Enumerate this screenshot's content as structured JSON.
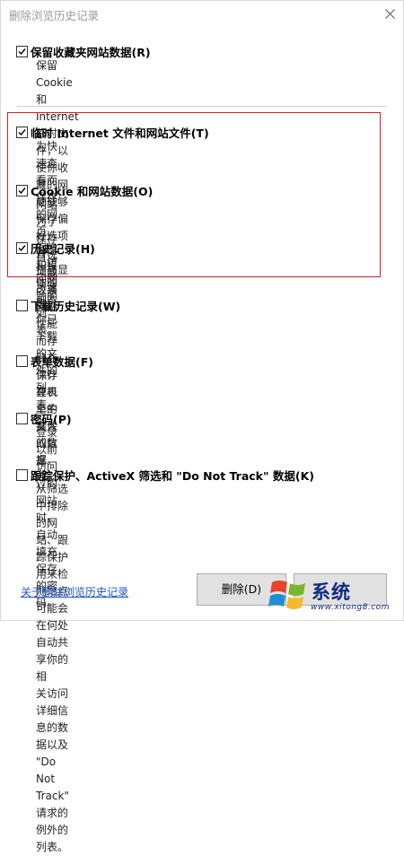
{
  "dialog": {
    "title": "删除浏览历史记录",
    "close_icon": "close-icon"
  },
  "options": [
    {
      "label": "保留收藏夹网站数据(R)",
      "checked": true,
      "description": [
        "保留 Cookie 和 Internet 临时文件，以使你收藏的网站能够保存偏好选项并",
        "提高显示速度。"
      ]
    },
    {
      "label": "临时 Internet 文件和网站文件(T)",
      "checked": true,
      "description": [
        "为快速查看而保存的网页、图像和媒体的副本"
      ]
    },
    {
      "label": "Cookie 和网站数据(O)",
      "checked": true,
      "description": [
        "网站为了保存首选项或改善网站性能而存储在你计算机上的文件或数",
        "据库。"
      ]
    },
    {
      "label": "历史记录(H)",
      "checked": true,
      "description": [
        "已访问网站的列表。"
      ]
    },
    {
      "label": "下载历史记录(W)",
      "checked": false,
      "description": [
        "你已下载的文件的列表。"
      ]
    },
    {
      "label": "表单数据(F)",
      "checked": false,
      "description": [
        "保存在表单中键入的信息。"
      ]
    },
    {
      "label": "密码(P)",
      "checked": false,
      "description": [
        "登录以前访问过的网站时，自动填充保存的密码。"
      ]
    },
    {
      "label": "跟踪保护、ActiveX 筛选和 \"Do Not Track\" 数据(K)",
      "checked": false,
      "description": [
        "从筛选中排除的网站、跟踪保护用来检测站点可能会在何处自动共享你的相",
        "关访问详细信息的数据以及 \"Do Not Track\" 请求的例外的列表。"
      ]
    }
  ],
  "footer": {
    "link_text": "关于删除浏览历史记录",
    "delete_button": "删除(D)",
    "cancel_button": ""
  },
  "watermark": {
    "text": "系统",
    "url": "www.xitong8.com"
  },
  "colors": {
    "highlight_border": "#e21c23",
    "link": "#1c55c8"
  }
}
